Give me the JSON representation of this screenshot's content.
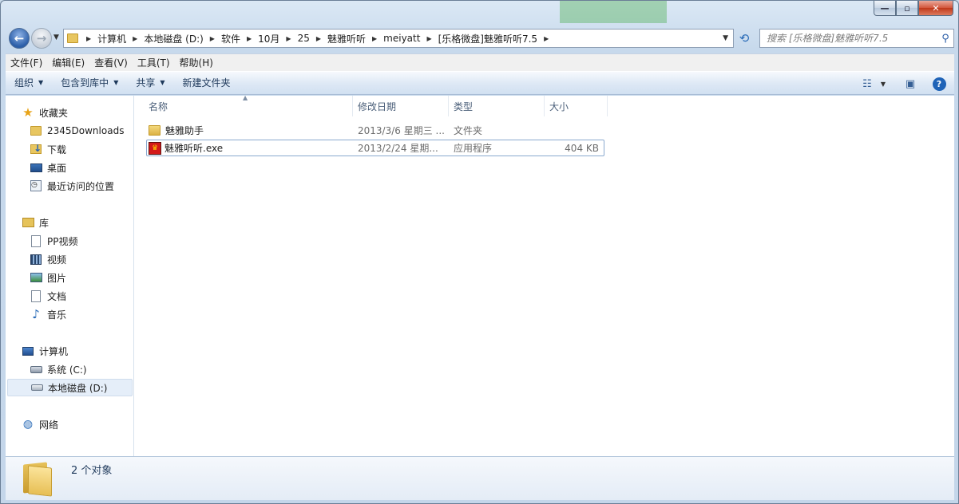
{
  "window": {
    "caption_min": "—",
    "caption_max": "▫",
    "caption_close": "✕"
  },
  "navigation": {
    "back_glyph": "←",
    "forward_glyph": "→",
    "breadcrumbs": [
      "计算机",
      "本地磁盘 (D:)",
      "软件",
      "10月",
      "25",
      "魅雅听听",
      "meiyatt",
      "[乐格微盘]魅雅听听7.5"
    ],
    "search_placeholder": "搜索 [乐格微盘]魅雅听听7.5"
  },
  "menu": [
    "文件(F)",
    "编辑(E)",
    "查看(V)",
    "工具(T)",
    "帮助(H)"
  ],
  "toolbar": {
    "organize": "组织",
    "include_in_library": "包含到库中",
    "share": "共享",
    "new_folder": "新建文件夹"
  },
  "sidebar": {
    "favorites": {
      "label": "收藏夹",
      "items": [
        "2345Downloads",
        "下载",
        "桌面",
        "最近访问的位置"
      ]
    },
    "libraries": {
      "label": "库",
      "items": [
        "PP视频",
        "视频",
        "图片",
        "文档",
        "音乐"
      ]
    },
    "computer": {
      "label": "计算机",
      "items": [
        "系统 (C:)",
        "本地磁盘 (D:)"
      ]
    },
    "network": {
      "label": "网络"
    }
  },
  "columns": {
    "name": "名称",
    "date": "修改日期",
    "type": "类型",
    "size": "大小"
  },
  "files": [
    {
      "name": "魅雅助手",
      "date": "2013/3/6 星期三 ...",
      "type": "文件夹",
      "size": ""
    },
    {
      "name": "魅雅听听.exe",
      "date": "2013/2/24 星期...",
      "type": "应用程序",
      "size": "404 KB"
    }
  ],
  "status": {
    "count_text": "2 个对象"
  },
  "colors": {
    "accent": "#1f63b7",
    "selection": "#e5eef9",
    "folder": "#e8c660"
  }
}
